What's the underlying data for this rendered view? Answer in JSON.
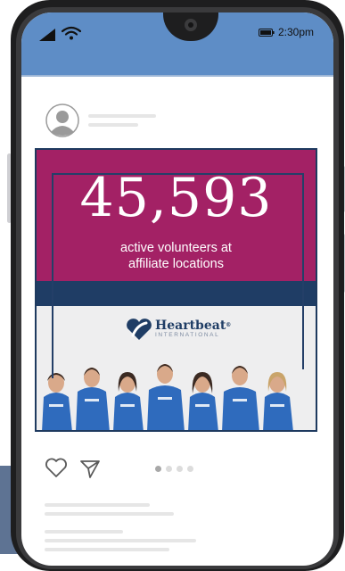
{
  "status_bar": {
    "time": "2:30pm",
    "icons": [
      "signal-icon",
      "wifi-icon",
      "battery-icon"
    ]
  },
  "post": {
    "stat_number": "45,593",
    "stat_caption_line1": "active volunteers at",
    "stat_caption_line2": "affiliate locations",
    "brand_name": "Heartbeat",
    "brand_mark": "®",
    "brand_sub": "INTERNATIONAL",
    "carousel": {
      "total": 4,
      "active_index": 0
    }
  },
  "colors": {
    "status_bar": "#5e8dc6",
    "magenta": "#a32165",
    "navy": "#1f3d65",
    "shirt_blue": "#2f6bbd"
  }
}
